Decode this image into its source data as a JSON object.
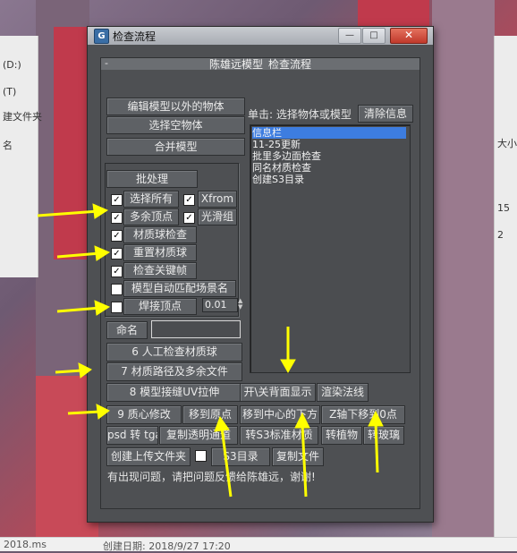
{
  "window": {
    "title": "检查流程",
    "controls": {
      "minimize": "—",
      "maximize": "□",
      "close": "✕"
    },
    "rollout_title": "陈雄远模型_检查流程",
    "rollout_toggle": "-"
  },
  "top_buttons": {
    "edit_other": "编辑模型以外的物体",
    "select_empty": "选择空物体",
    "merge_model": "合并模型"
  },
  "status": {
    "click_hint": "单击: 选择物体或模型",
    "clear_info": "清除信息"
  },
  "info_list": {
    "items": [
      "信息栏",
      "11-25更新",
      "批里多边面检查",
      "同名材质检查",
      "创建S3目录"
    ],
    "selected_index": 0
  },
  "batch": {
    "title": "批处理",
    "options": [
      {
        "label": "选择所有",
        "checked": true
      },
      {
        "label": "Xfrom",
        "checked": true
      },
      {
        "label": "多余顶点",
        "checked": true
      },
      {
        "label": "光滑组",
        "checked": true
      },
      {
        "label": "材质球检查",
        "checked": true
      },
      {
        "label": "重置材质球",
        "checked": true
      },
      {
        "label": "检查关键帧",
        "checked": true
      },
      {
        "label": "模型自动匹配场景名",
        "checked": false
      },
      {
        "label": "焊接顶点",
        "checked": false
      }
    ],
    "weld_value": "0.01"
  },
  "naming": {
    "label": "命名",
    "value": ""
  },
  "actions": {
    "manual_check": "6 人工检查材质球",
    "material_path": "7 材质路径及多余文件",
    "seam_uv": "8  模型接缝UV拉伸",
    "backface": "开\\关背面显示",
    "render_normals": "渲染法线",
    "quality_fix": "9 质心修改",
    "move_origin": "移到原点",
    "move_center_bottom": "移到中心的下方",
    "z_to_zero": "Z轴下移到0点",
    "psd_to_tga": "psd 转 tga",
    "copy_transparent": "复制透明通道",
    "to_s3_material": "转S3标准材质",
    "to_plant": "转植物",
    "to_glass": "转玻璃",
    "create_upload": "创建上传文件夹",
    "s3_dir": "S3目录",
    "copy_file": "复制文件"
  },
  "footer_note": "有出现问题，请把问题反馈给陈雄远，谢谢!",
  "background": {
    "bottom_left": "2018.ms",
    "bottom_mid": "创建日期: 2018/9/27 17:20",
    "left_labels": [
      "(D:)",
      "(T)",
      "建文件夹",
      "名"
    ],
    "right_labels": [
      "大小",
      "15",
      "2"
    ]
  },
  "colors": {
    "arrow": "#ffff00",
    "selection": "#3d7de0",
    "panel": "#4e5053",
    "titlebar": "#b8bbc1"
  }
}
